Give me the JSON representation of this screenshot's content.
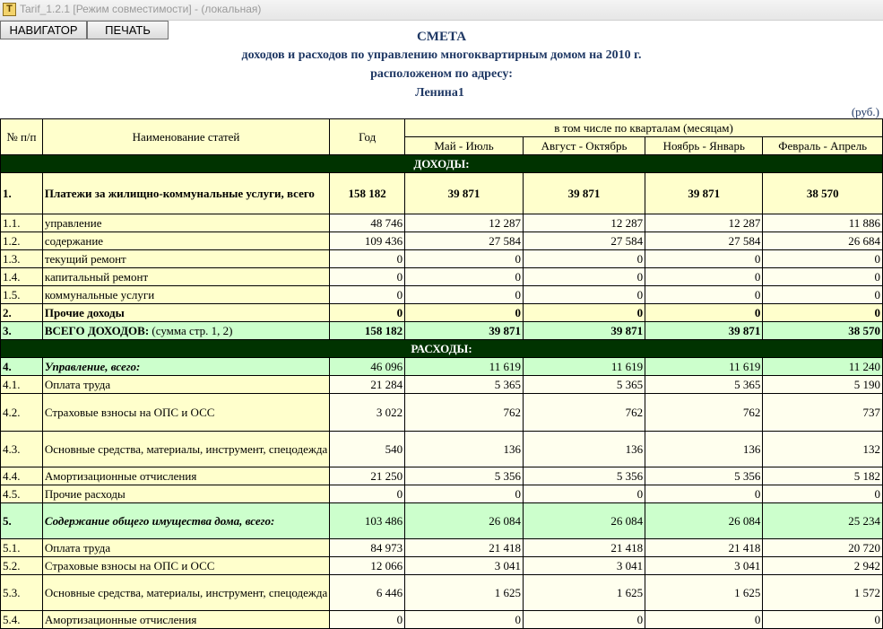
{
  "window": {
    "title": "Tarif_1.2.1  [Режим совместимости] - (локальная)",
    "icon": "app-icon-T"
  },
  "toolbar": {
    "navigator_label": "НАВИГАТОР",
    "print_label": "ПЕЧАТЬ"
  },
  "header": {
    "line1": "СМЕТА",
    "line2": "доходов и расходов по управлению многоквартирным домом на 2010 г.",
    "line3": "расположеном по адресу:",
    "line4": "Ленина1",
    "unit": "(руб.)"
  },
  "table": {
    "col_num": "№ п/п",
    "col_name": "Наименование статей",
    "col_year": "Год",
    "col_quarters": "в том числе по кварталам (месяцам)",
    "q1": "Май - Июль",
    "q2": "Август - Октябрь",
    "q3": "Ноябрь - Январь",
    "q4": "Февраль - Апрель",
    "income_header": "ДОХОДЫ:",
    "expense_header": "РАСХОДЫ:",
    "rows": [
      {
        "num": "1.",
        "name": "Платежи за жилищно-коммунальные услуги, всего",
        "year": "158 182",
        "q1": "39 871",
        "q2": "39 871",
        "q3": "39 871",
        "q4": "38 570"
      },
      {
        "num": "1.1.",
        "name": "управление",
        "year": "48 746",
        "q1": "12 287",
        "q2": "12 287",
        "q3": "12 287",
        "q4": "11 886"
      },
      {
        "num": "1.2.",
        "name": "содержание",
        "year": "109 436",
        "q1": "27 584",
        "q2": "27 584",
        "q3": "27 584",
        "q4": "26 684"
      },
      {
        "num": "1.3.",
        "name": "текущий ремонт",
        "year": "0",
        "q1": "0",
        "q2": "0",
        "q3": "0",
        "q4": "0"
      },
      {
        "num": "1.4.",
        "name": "капитальный ремонт",
        "year": "0",
        "q1": "0",
        "q2": "0",
        "q3": "0",
        "q4": "0"
      },
      {
        "num": "1.5.",
        "name": "коммунальные услуги",
        "year": "0",
        "q1": "0",
        "q2": "0",
        "q3": "0",
        "q4": "0"
      },
      {
        "num": "2.",
        "name": "Прочие  доходы",
        "year": "0",
        "q1": "0",
        "q2": "0",
        "q3": "0",
        "q4": "0"
      },
      {
        "num": "3.",
        "name_bold": "ВСЕГО ДОХОДОВ:",
        "name_rest": " (сумма стр. 1, 2)",
        "year": "158 182",
        "q1": "39 871",
        "q2": "39 871",
        "q3": "39 871",
        "q4": "38 570"
      },
      {
        "num": "4.",
        "name": "Управление, всего:",
        "year": "46 096",
        "q1": "11 619",
        "q2": "11 619",
        "q3": "11 619",
        "q4": "11 240"
      },
      {
        "num": "4.1.",
        "name": "Оплата труда",
        "year": "21 284",
        "q1": "5 365",
        "q2": "5 365",
        "q3": "5 365",
        "q4": "5 190"
      },
      {
        "num": "4.2.",
        "name": "Страховые взносы на ОПС и ОСС",
        "year": "3 022",
        "q1": "762",
        "q2": "762",
        "q3": "762",
        "q4": "737"
      },
      {
        "num": "4.3.",
        "name": "Основные средства, материалы, инструмент, спецодежда",
        "year": "540",
        "q1": "136",
        "q2": "136",
        "q3": "136",
        "q4": "132"
      },
      {
        "num": "4.4.",
        "name": "Амортизационные отчисления",
        "year": "21 250",
        "q1": "5 356",
        "q2": "5 356",
        "q3": "5 356",
        "q4": "5 182"
      },
      {
        "num": "4.5.",
        "name": "Прочие расходы",
        "year": "0",
        "q1": "0",
        "q2": "0",
        "q3": "0",
        "q4": "0"
      },
      {
        "num": "5.",
        "name": "Содержание общего имущества дома, всего:",
        "year": "103 486",
        "q1": "26 084",
        "q2": "26 084",
        "q3": "26 084",
        "q4": "25 234"
      },
      {
        "num": "5.1.",
        "name": "Оплата труда",
        "year": "84 973",
        "q1": "21 418",
        "q2": "21 418",
        "q3": "21 418",
        "q4": "20 720"
      },
      {
        "num": "5.2.",
        "name": "Страховые взносы на ОПС и ОСС",
        "year": "12 066",
        "q1": "3 041",
        "q2": "3 041",
        "q3": "3 041",
        "q4": "2 942"
      },
      {
        "num": "5.3.",
        "name": "Основные средства, материалы, инструмент, спецодежда",
        "year": "6 446",
        "q1": "1 625",
        "q2": "1 625",
        "q3": "1 625",
        "q4": "1 572"
      },
      {
        "num": "5.4.",
        "name": "Амортизационные отчисления",
        "year": "0",
        "q1": "0",
        "q2": "0",
        "q3": "0",
        "q4": "0"
      }
    ]
  }
}
